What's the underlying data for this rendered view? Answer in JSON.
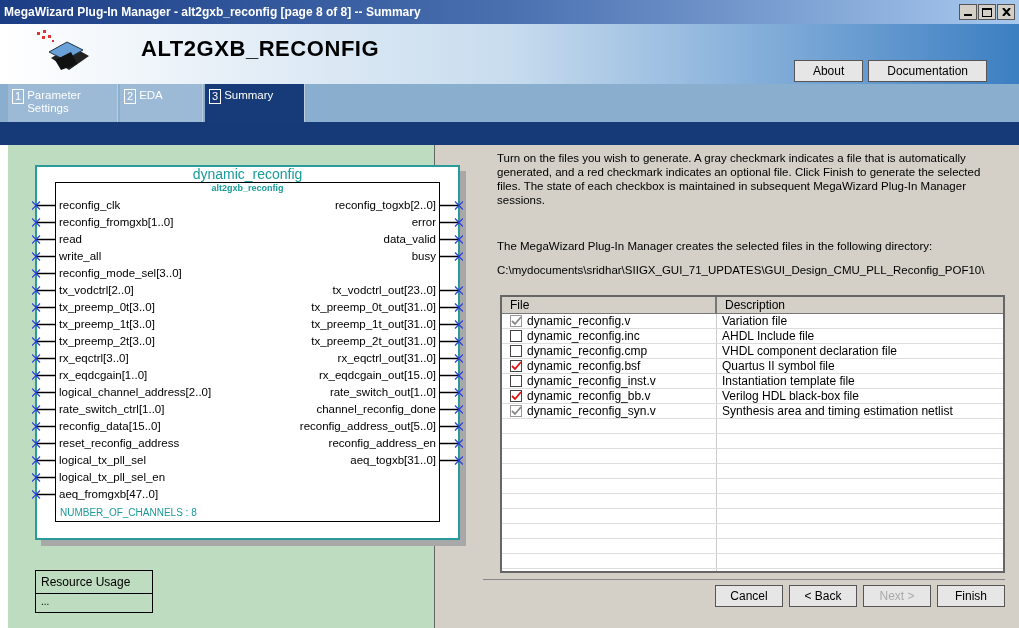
{
  "window": {
    "title": "MegaWizard Plug-In Manager - alt2gxb_reconfig [page 8 of 8] -- Summary"
  },
  "header": {
    "title": "ALT2GXB_RECONFIG",
    "buttons": [
      "About",
      "Documentation"
    ]
  },
  "tabs": [
    {
      "number": "1",
      "label": "Parameter Settings",
      "selected": false
    },
    {
      "number": "2",
      "label": "EDA",
      "selected": false
    },
    {
      "number": "3",
      "label": "Summary",
      "selected": true
    }
  ],
  "symbol": {
    "instance": "dynamic_reconfig",
    "module": "alt2gxb_reconfig",
    "parameter": "NUMBER_OF_CHANNELS : 8",
    "rows": [
      {
        "input": "reconfig_clk",
        "output": "reconfig_togxb[2..0]"
      },
      {
        "input": "reconfig_fromgxb[1..0]",
        "output": "error"
      },
      {
        "input": "read",
        "output": "data_valid"
      },
      {
        "input": "write_all",
        "output": "busy"
      },
      {
        "input": "reconfig_mode_sel[3..0]"
      },
      {
        "input": "tx_vodctrl[2..0]",
        "output": "tx_vodctrl_out[23..0]"
      },
      {
        "input": "tx_preemp_0t[3..0]",
        "output": "tx_preemp_0t_out[31..0]"
      },
      {
        "input": "tx_preemp_1t[3..0]",
        "output": "tx_preemp_1t_out[31..0]"
      },
      {
        "input": "tx_preemp_2t[3..0]",
        "output": "tx_preemp_2t_out[31..0]"
      },
      {
        "input": "rx_eqctrl[3..0]",
        "output": "rx_eqctrl_out[31..0]"
      },
      {
        "input": "rx_eqdcgain[1..0]",
        "output": "rx_eqdcgain_out[15..0]"
      },
      {
        "input": "logical_channel_address[2..0]",
        "output": "rate_switch_out[1..0]"
      },
      {
        "input": "rate_switch_ctrl[1..0]",
        "output": "channel_reconfig_done"
      },
      {
        "input": "reconfig_data[15..0]",
        "output": "reconfig_address_out[5..0]"
      },
      {
        "input": "reset_reconfig_address",
        "output": "reconfig_address_en"
      },
      {
        "input": "logical_tx_pll_sel",
        "output": "aeq_togxb[31..0]"
      },
      {
        "input": "logical_tx_pll_sel_en"
      },
      {
        "input": "aeq_fromgxb[47..0]"
      }
    ]
  },
  "resource_usage": {
    "title": "Resource Usage",
    "value": "..."
  },
  "summary": {
    "intro": "Turn on the files you wish to generate. A gray checkmark indicates a file that is automatically generated, and a red checkmark indicates an optional file. Click Finish to generate the selected files. The state of each checkbox is maintained in subsequent MegaWizard Plug-In Manager sessions.",
    "directory_label": "The MegaWizard Plug-In Manager creates the selected files in the following directory:",
    "directory": "C:\\mydocuments\\sridhar\\SIIGX_GUI_71_UPDATES\\GUI_Design_CMU_PLL_Reconfig_POF10\\"
  },
  "files": {
    "columns": [
      "File",
      "Description"
    ],
    "rows": [
      {
        "file": "dynamic_reconfig.v",
        "description": "Variation file",
        "checked": true,
        "kind": "auto"
      },
      {
        "file": "dynamic_reconfig.inc",
        "description": "AHDL Include file",
        "checked": false,
        "kind": "optional"
      },
      {
        "file": "dynamic_reconfig.cmp",
        "description": "VHDL component declaration file",
        "checked": false,
        "kind": "optional"
      },
      {
        "file": "dynamic_reconfig.bsf",
        "description": "Quartus II symbol file",
        "checked": true,
        "kind": "optional"
      },
      {
        "file": "dynamic_reconfig_inst.v",
        "description": "Instantiation template file",
        "checked": false,
        "kind": "optional"
      },
      {
        "file": "dynamic_reconfig_bb.v",
        "description": "Verilog HDL black-box file",
        "checked": true,
        "kind": "optional"
      },
      {
        "file": "dynamic_reconfig_syn.v",
        "description": "Synthesis area and timing estimation netlist",
        "checked": true,
        "kind": "auto"
      }
    ]
  },
  "footer": {
    "buttons": [
      {
        "label": "Cancel",
        "disabled": false
      },
      {
        "label": "< Back",
        "disabled": false
      },
      {
        "label": "Next >",
        "disabled": true
      },
      {
        "label": "Finish",
        "disabled": false
      }
    ]
  }
}
